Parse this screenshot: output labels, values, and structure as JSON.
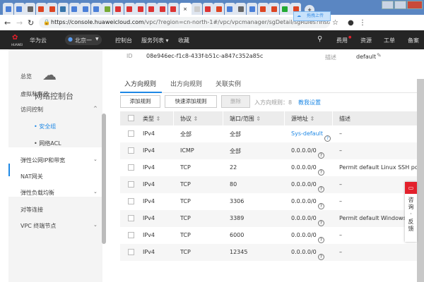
{
  "browser": {
    "url_host": "https://console.huaweicloud.com",
    "url_path": "/vpc/?region=cn-north-1#/vpc/vpcmanager/sgDetail/sgRules?instanceId=08e9...",
    "upload_label": "拖拽上传"
  },
  "header": {
    "brand": "华为云",
    "logo_text": "HUAWEI",
    "region": "北京一",
    "nav": [
      "控制台",
      "服务列表",
      "收藏"
    ],
    "right": [
      "费用",
      "资源",
      "工单",
      "备案"
    ]
  },
  "sidebar": {
    "title": "网络控制台",
    "items": [
      {
        "label": "总览"
      },
      {
        "label": "虚拟私有云"
      },
      {
        "label": "访问控制",
        "expanded": true
      },
      {
        "label": "安全组",
        "active": true,
        "sub": true
      },
      {
        "label": "网络ACL",
        "sub": true
      },
      {
        "label": "弹性公网IP和带宽"
      },
      {
        "label": "NAT网关"
      },
      {
        "label": "弹性负载均衡"
      },
      {
        "label": "对等连接"
      },
      {
        "label": "VPC 终端节点"
      }
    ]
  },
  "detail": {
    "id_label": "ID",
    "id_value": "08e946ec-f1c8-433f-b51c-a847c352a85c",
    "desc_label": "描述",
    "desc_value": "default"
  },
  "tabs": [
    "入方向规则",
    "出方向规则",
    "关联实例"
  ],
  "toolbar": {
    "add": "添加规则",
    "quick_add": "快速添加规则",
    "delete": "删除",
    "count_label": "入方向规则：8",
    "help": "教我设置"
  },
  "table": {
    "headers": [
      "类型",
      "协议",
      "端口/范围",
      "源地址",
      "描述"
    ],
    "rows": [
      [
        "IPv4",
        "全部",
        "全部",
        "Sys-default",
        "–"
      ],
      [
        "IPv4",
        "ICMP",
        "全部",
        "0.0.0.0/0",
        "–"
      ],
      [
        "IPv4",
        "TCP",
        "22",
        "0.0.0.0/0",
        "Permit default Linux SSH port."
      ],
      [
        "IPv4",
        "TCP",
        "80",
        "0.0.0.0/0",
        "–"
      ],
      [
        "IPv4",
        "TCP",
        "3306",
        "0.0.0.0/0",
        "–"
      ],
      [
        "IPv4",
        "TCP",
        "3389",
        "0.0.0.0/0",
        "Permit default Windows remote"
      ],
      [
        "IPv4",
        "TCP",
        "6000",
        "0.0.0.0/0",
        "–"
      ],
      [
        "IPv4",
        "TCP",
        "12345",
        "0.0.0.0/0",
        "–"
      ]
    ]
  },
  "feedback": {
    "label": "咨询·反馈"
  },
  "colors": {
    "accent": "#1e88e5",
    "header_bg": "#252525",
    "feedback": "#e3202b"
  }
}
